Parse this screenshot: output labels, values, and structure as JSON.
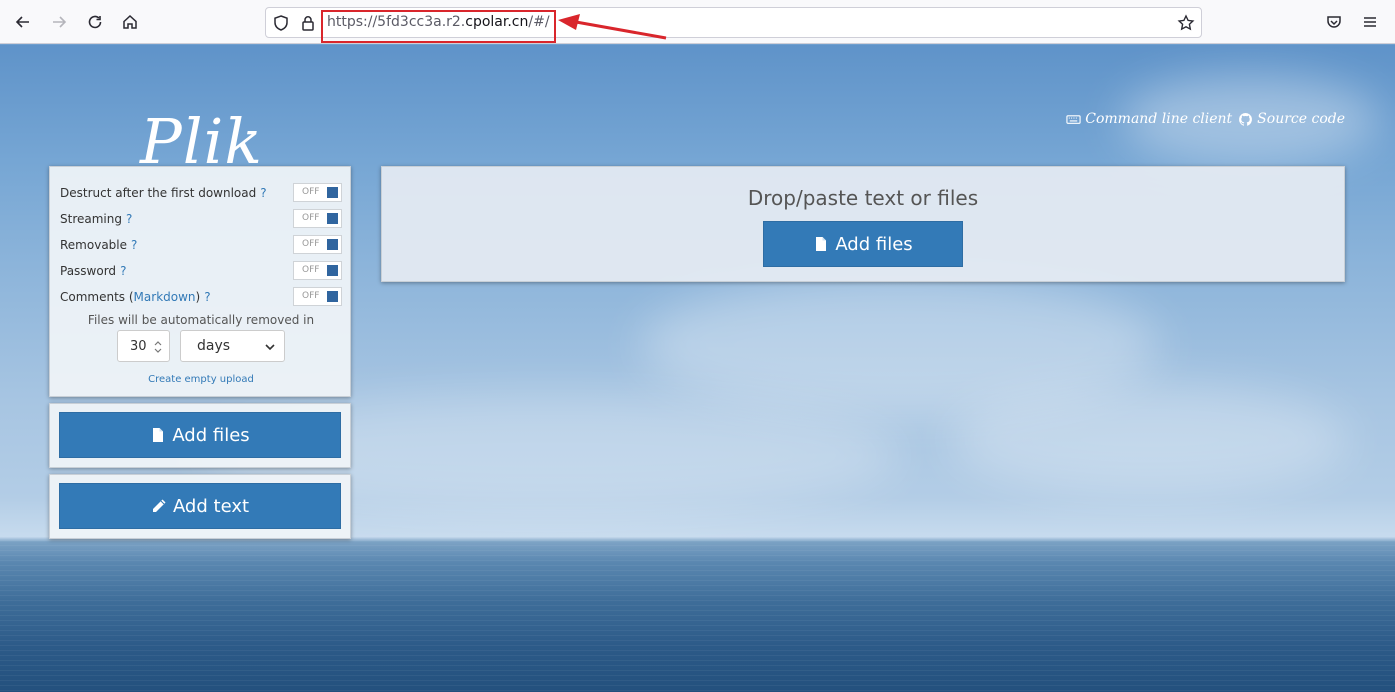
{
  "browser": {
    "url_prefix": "https://5fd3cc3a.r2.",
    "url_domain": "cpolar.cn",
    "url_suffix": "/#/"
  },
  "header": {
    "logo": "Plik",
    "cli_link": "Command line client",
    "source_link": "Source code"
  },
  "settings": {
    "options": [
      {
        "label": "Destruct after the first download",
        "help": "?",
        "state": "OFF"
      },
      {
        "label": "Streaming",
        "help": "?",
        "state": "OFF"
      },
      {
        "label": "Removable",
        "help": "?",
        "state": "OFF"
      },
      {
        "label": "Password",
        "help": "?",
        "state": "OFF"
      }
    ],
    "comments": {
      "prefix": "Comments (",
      "link": "Markdown",
      "suffix": ")",
      "help": "?",
      "state": "OFF"
    },
    "ttl_label": "Files will be automatically removed in",
    "ttl_value": "30",
    "ttl_unit": "days",
    "empty_upload": "Create empty upload"
  },
  "actions": {
    "add_files": "Add files",
    "add_text": "Add text"
  },
  "dropzone": {
    "title": "Drop/paste text or files",
    "button": "Add files"
  },
  "colors": {
    "primary": "#337ab7",
    "annotation": "#d9262c"
  }
}
